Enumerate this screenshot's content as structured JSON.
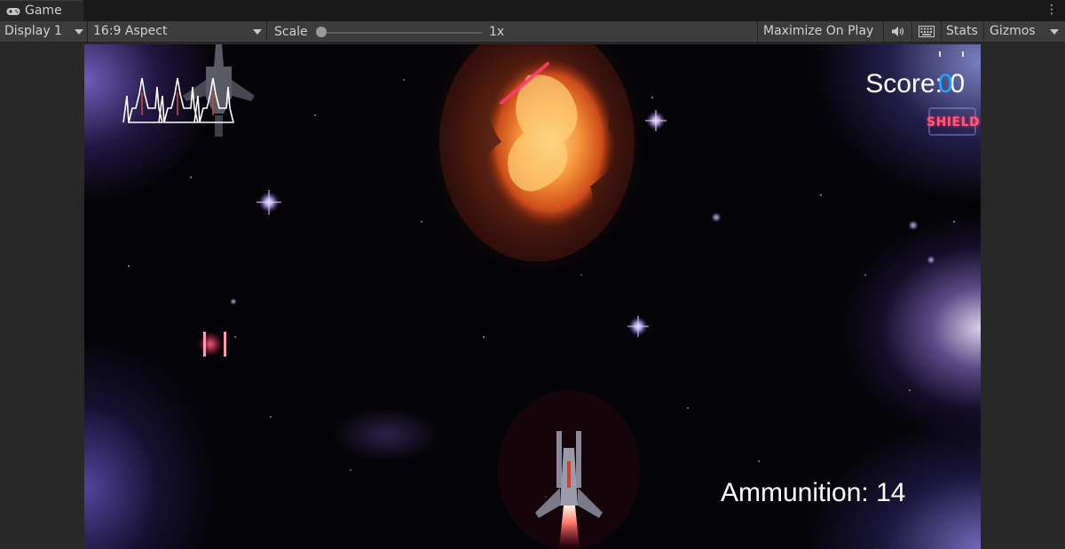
{
  "editor": {
    "tab_title": "Game",
    "display": "Display 1",
    "aspect": "16:9 Aspect",
    "scale_label": "Scale",
    "scale_value": "1x",
    "scale_level": 0.0,
    "maximize_on_play": "Maximize On Play",
    "stats": "Stats",
    "gizmos": "Gizmos",
    "icons": {
      "tab": "gamepad-icon",
      "menu": "kebab-menu-icon",
      "audio": "speaker-icon",
      "keyboard": "keyboard-icon"
    }
  },
  "game": {
    "score_label": "Score: ",
    "score_value": "0",
    "shield_label": "SHIELD",
    "shield_count": "0",
    "ammo_label": "Ammunition: ",
    "ammo_value": "14",
    "lives": 3,
    "colors": {
      "background": "#040307",
      "hud_text": "#ffffff",
      "shield_blue": "#22a7ff",
      "shield_label": "#ff5a78",
      "laser": "#ff3c6e"
    }
  }
}
